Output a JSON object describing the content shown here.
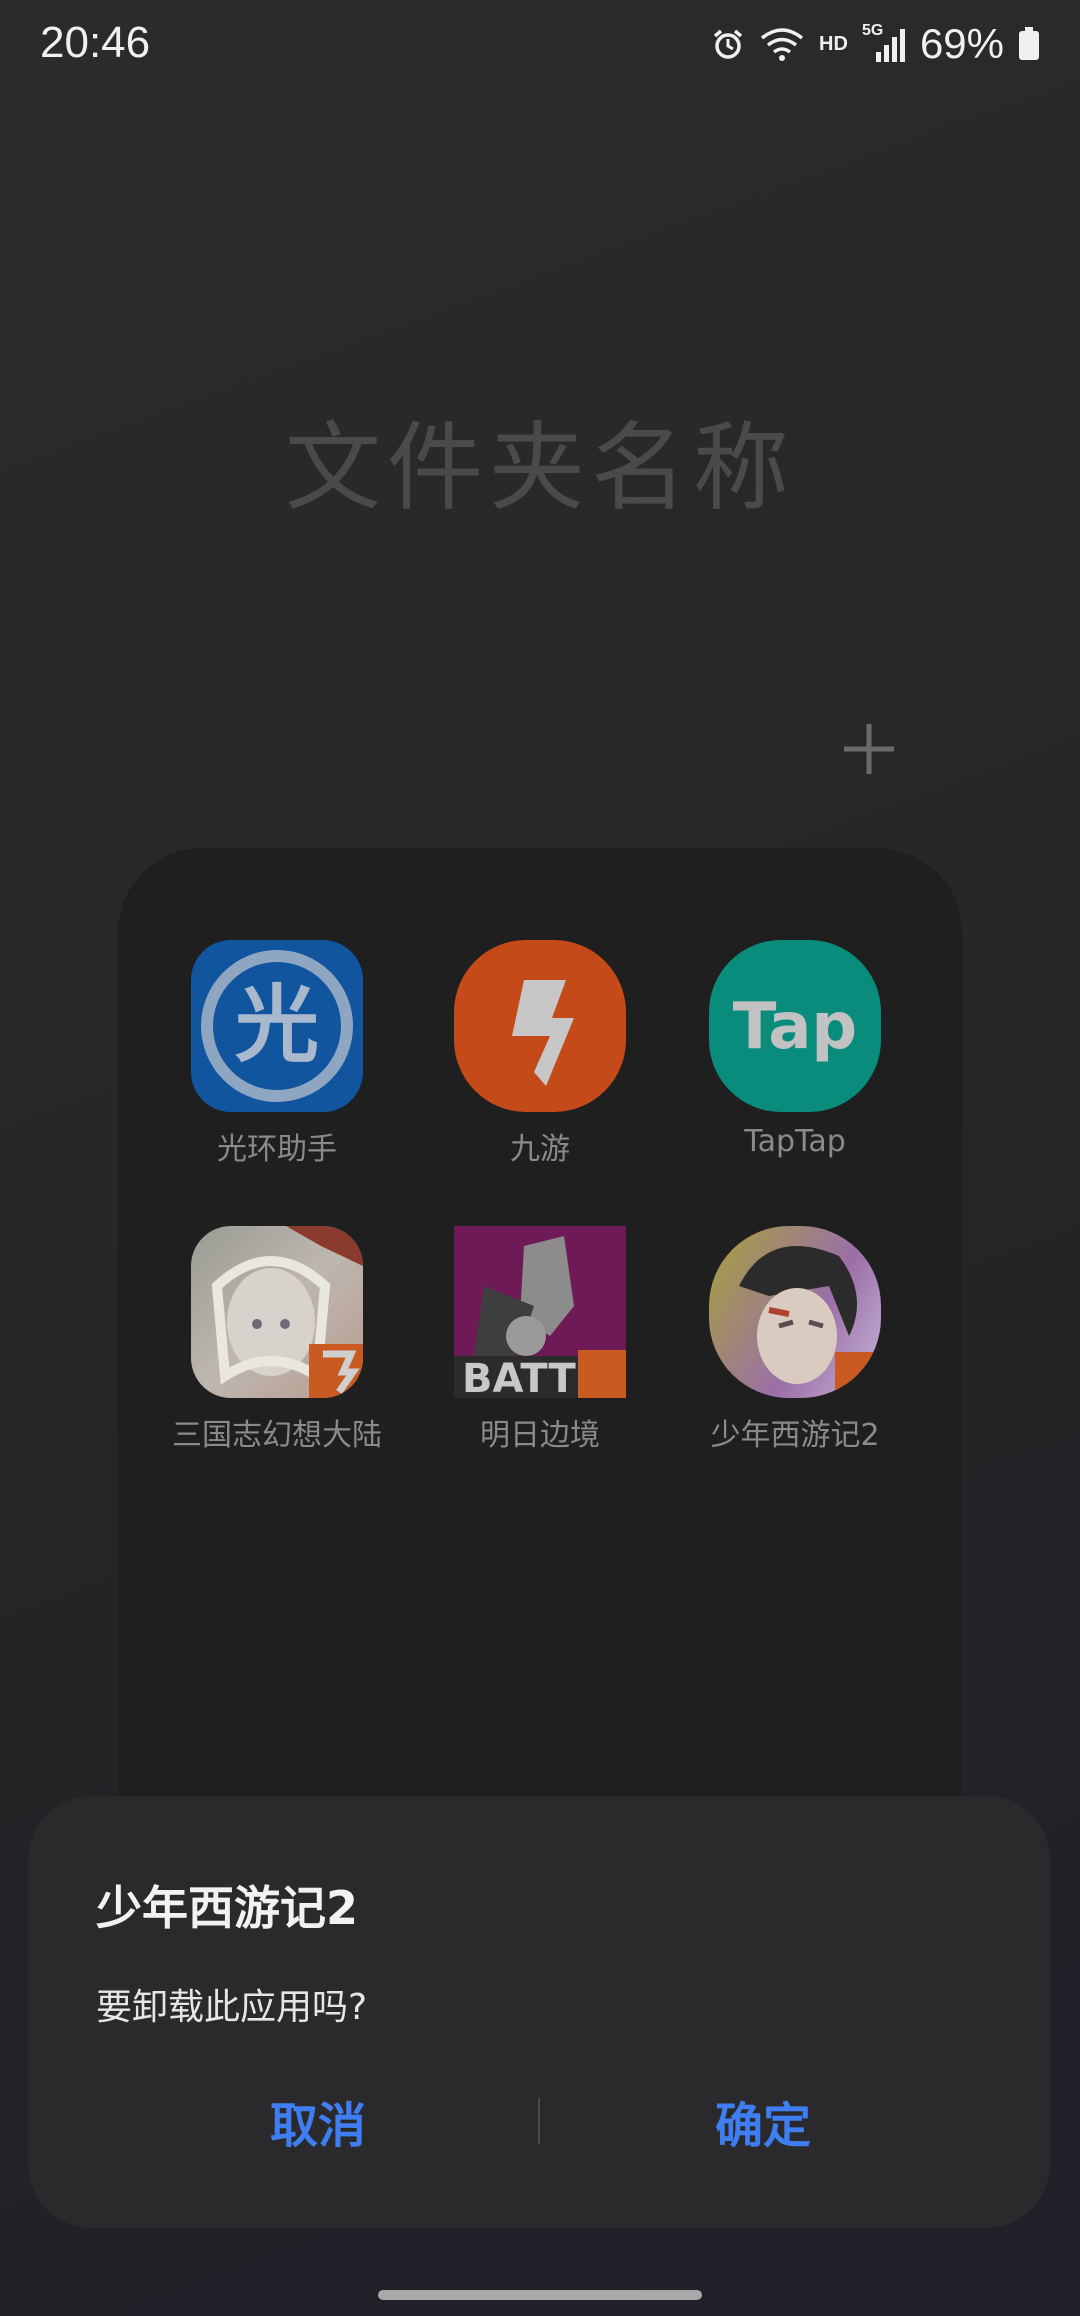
{
  "status_bar": {
    "time": "20:46",
    "network_label": "HD",
    "cell_label": "5G",
    "battery_percent": "69%"
  },
  "folder": {
    "title": "文件夹名称",
    "apps": [
      {
        "label": "光环助手",
        "icon": "guanghuan-icon",
        "color": "#1462b8"
      },
      {
        "label": "九游",
        "icon": "jiuyou-icon",
        "color": "#e0531c"
      },
      {
        "label": "TapTap",
        "icon": "taptap-icon",
        "color": "#0fb3a0",
        "icon_text": "Tap"
      },
      {
        "label": "三国志幻想大陆",
        "icon": "sanguozhi-game-icon"
      },
      {
        "label": "明日边境",
        "icon": "mingri-bianjing-game-icon",
        "icon_text": "BATTL"
      },
      {
        "label": "少年西游记2",
        "icon": "shaonian-xiyouji2-game-icon"
      }
    ]
  },
  "dialog": {
    "title": "少年西游记2",
    "message": "要卸载此应用吗?",
    "cancel_label": "取消",
    "confirm_label": "确定",
    "accent_color": "#3f7ef2"
  }
}
